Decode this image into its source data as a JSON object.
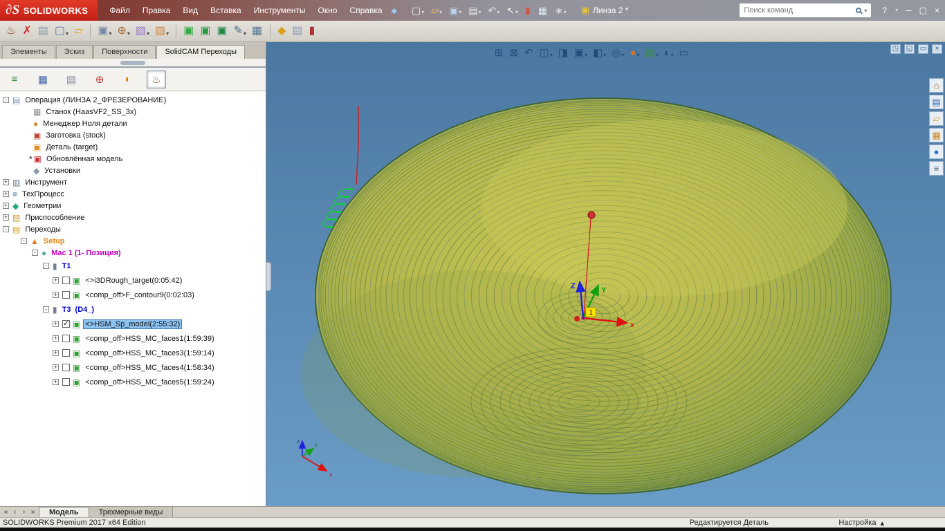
{
  "titlebar": {
    "logo_mark": "∂S",
    "logo_text": "SOLIDWORKS",
    "menus": [
      "Файл",
      "Правка",
      "Вид",
      "Вставка",
      "Инструменты",
      "Окно",
      "Справка"
    ],
    "toolbar_icons": [
      {
        "n": "new-document-icon",
        "g": "▢",
        "c": "#eef3f8",
        "d": "▾"
      },
      {
        "n": "open-document-icon",
        "g": "▱",
        "c": "#f3c96a",
        "d": "▾"
      },
      {
        "n": "save-icon",
        "g": "▣",
        "c": "#bcd2ee",
        "d": "▾"
      },
      {
        "n": "print-icon",
        "g": "▤",
        "c": "#e8e8e8",
        "d": "▾"
      },
      {
        "n": "undo-icon",
        "g": "↶",
        "c": "#e8e8e8",
        "d": "▾"
      },
      {
        "n": "select-cursor-icon",
        "g": "↖",
        "c": "#f2f2f2",
        "d": "▾"
      },
      {
        "n": "rebuild-icon",
        "g": "▮",
        "c": "#cc5544",
        "d": ""
      },
      {
        "n": "task-list-icon",
        "g": "▦",
        "c": "#dce6f0",
        "d": ""
      },
      {
        "n": "options-gear-icon",
        "g": "∗",
        "c": "#e4e4e4",
        "d": "▾"
      }
    ],
    "doc_title": "Линза 2 *",
    "search_placeholder": "Поиск команд",
    "window": {
      "help": "?",
      "help_dd": "▾",
      "min": "─",
      "max": "▢",
      "close": "×"
    }
  },
  "solidcam_toolbar": [
    {
      "n": "solidcam-icon",
      "g": "♨",
      "c": "#8a4a20",
      "d": "",
      "cls": ""
    },
    {
      "n": "close-part-icon",
      "g": "✗",
      "c": "#cc2222",
      "d": "",
      "cls": ""
    },
    {
      "n": "save-cam-icon",
      "g": "▤",
      "c": "#8899aa",
      "d": "",
      "cls": ""
    },
    {
      "n": "new-cam-part-icon",
      "g": "▢",
      "c": "#5577aa",
      "d": "▾",
      "cls": ""
    },
    {
      "n": "open-cam-part-icon",
      "g": "▱",
      "c": "#d9a21b",
      "d": "",
      "cls": ""
    },
    {
      "n": "separator",
      "g": "",
      "c": "",
      "d": "",
      "cls": "sep"
    },
    {
      "n": "machine-setup-icon",
      "g": "▣",
      "c": "#7788aa",
      "d": "▾",
      "cls": ""
    },
    {
      "n": "coordinate-manager-icon",
      "g": "⊕",
      "c": "#aa6633",
      "d": "▾",
      "cls": ""
    },
    {
      "n": "stock-model-icon",
      "g": "▧",
      "c": "#9977cc",
      "d": "▾",
      "cls": ""
    },
    {
      "n": "target-model-icon",
      "g": "▨",
      "c": "#cc8844",
      "d": "▾",
      "cls": ""
    },
    {
      "n": "separator",
      "g": "",
      "c": "",
      "d": "",
      "cls": "sep"
    },
    {
      "n": "operation-2d-icon",
      "g": "▣",
      "c": "#33aa44",
      "d": "",
      "cls": ""
    },
    {
      "n": "operation-3d-icon",
      "g": "▣",
      "c": "#2a9944",
      "d": "",
      "cls": ""
    },
    {
      "n": "operation-hsm-icon",
      "g": "▣",
      "c": "#22884a",
      "d": "",
      "cls": ""
    },
    {
      "n": "edit-operation-icon",
      "g": "✎",
      "c": "#446688",
      "d": "▾",
      "cls": ""
    },
    {
      "n": "calculator-icon",
      "g": "▦",
      "c": "#557799",
      "d": "",
      "cls": ""
    },
    {
      "n": "separator",
      "g": "",
      "c": "",
      "d": "",
      "cls": "sep"
    },
    {
      "n": "license-key-icon",
      "g": "◆",
      "c": "#d9a21b",
      "d": "",
      "cls": ""
    },
    {
      "n": "documentation-icon",
      "g": "▤",
      "c": "#8899bb",
      "d": "",
      "cls": ""
    },
    {
      "n": "material-db-icon",
      "g": "▮",
      "c": "#aa3333",
      "d": "",
      "cls": ""
    }
  ],
  "command_tabs": [
    {
      "label": "Элементы",
      "cls": ""
    },
    {
      "label": "Эскиз",
      "cls": ""
    },
    {
      "label": "Поверхности",
      "cls": ""
    },
    {
      "label": "SolidCAM Переходы",
      "cls": "active"
    }
  ],
  "manager_tabs": [
    {
      "n": "featuremanager-tab",
      "g": "≡",
      "c": "#3a8a3a",
      "cls": ""
    },
    {
      "n": "propertymanager-tab",
      "g": "▦",
      "c": "#4466aa",
      "cls": ""
    },
    {
      "n": "configurationmanager-tab",
      "g": "▤",
      "c": "#888899",
      "cls": ""
    },
    {
      "n": "dimxpertmanager-tab",
      "g": "⊕",
      "c": "#cc3333",
      "cls": ""
    },
    {
      "n": "displaymanager-tab",
      "g": "◐",
      "c": "#dd8800",
      "cls": ""
    },
    {
      "n": "solidcam-manager-tab",
      "g": "♨",
      "c": "#8a4a20",
      "cls": "active"
    }
  ],
  "tree": {
    "items": [
      {
        "ml": "4px",
        "exp": "-",
        "pre": "",
        "glyph": "▤",
        "gc": "#7a8fb5",
        "label": "Операция (ЛИНЗА 2_ФРЕЗЕРОВАНИЕ)",
        "cls": ""
      },
      {
        "ml": "34px",
        "exp": "",
        "pre": "",
        "glyph": "▦",
        "gc": "#8a8f98",
        "label": "Станок (HaasVF2_SS_3x)",
        "cls": ""
      },
      {
        "ml": "34px",
        "exp": "",
        "pre": "",
        "glyph": "●",
        "gc": "#cc8833",
        "label": "Менеджер Ноля детали",
        "cls": ""
      },
      {
        "ml": "34px",
        "exp": "",
        "pre": "",
        "glyph": "▣",
        "gc": "#bb4433",
        "label": "Заготовка (stock)",
        "cls": ""
      },
      {
        "ml": "34px",
        "exp": "",
        "pre": "",
        "glyph": "▣",
        "gc": "#dd8822",
        "label": "Деталь (target)",
        "cls": ""
      },
      {
        "ml": "28px",
        "exp": "",
        "pre": "*",
        "glyph": "▣",
        "gc": "#cc3333",
        "label": "Обновлённая модель",
        "cls": ""
      },
      {
        "ml": "34px",
        "exp": "",
        "pre": "",
        "glyph": "◆",
        "gc": "#8899aa",
        "label": "Установки",
        "cls": ""
      },
      {
        "ml": "4px",
        "exp": "+",
        "pre": "",
        "glyph": "▥",
        "gc": "#667788",
        "label": "Инструмент",
        "cls": ""
      },
      {
        "ml": "4px",
        "exp": "+",
        "pre": "",
        "glyph": "≡",
        "gc": "#336699",
        "label": "ТехПроцесс",
        "cls": ""
      },
      {
        "ml": "4px",
        "exp": "+",
        "pre": "",
        "glyph": "◆",
        "gc": "#22aa77",
        "label": "Геометрии",
        "cls": ""
      },
      {
        "ml": "4px",
        "exp": "+",
        "pre": "",
        "glyph": "▤",
        "gc": "#c8961e",
        "label": "Приспособление",
        "cls": ""
      },
      {
        "ml": "4px",
        "exp": "-",
        "pre": "",
        "glyph": "▤",
        "gc": "#e0a020",
        "label": "Переходы",
        "cls": ""
      },
      {
        "ml": "30px",
        "exp": "-",
        "pre": "",
        "glyph": "▲",
        "gc": "#e07820",
        "label": "Setup",
        "cls": "orange"
      },
      {
        "ml": "46px",
        "exp": "-",
        "pre": "",
        "glyph": "●",
        "gc": "#55aa99",
        "label": "Mac 1 (1- Позиция)",
        "cls": "magenta"
      },
      {
        "ml": "62px",
        "exp": "-",
        "pre": "",
        "glyph": "▮",
        "gc": "#708090",
        "label": "T1",
        "cls": "blue tall"
      },
      {
        "ml": "76px",
        "exp": "+",
        "pre": "",
        "glyph": "▣",
        "gc": "#33a033",
        "label": "<>i3DRough_target(0:05:42)",
        "cls": "ck0 tall"
      },
      {
        "ml": "76px",
        "exp": "+",
        "pre": "",
        "glyph": "▣",
        "gc": "#33a033",
        "label": "<comp_off>F_contour9(0:02:03)",
        "cls": "ck0 tall"
      },
      {
        "ml": "62px",
        "exp": "-",
        "pre": "",
        "glyph": "▮",
        "gc": "#708090",
        "label": "T3  (D4_)",
        "cls": "blue tall"
      },
      {
        "ml": "76px",
        "exp": "+",
        "pre": "",
        "glyph": "▣",
        "gc": "#33a033",
        "label": "<>HSM_Sp_model(2:55:32)",
        "cls": "ck1 sel tall"
      },
      {
        "ml": "76px",
        "exp": "+",
        "pre": "",
        "glyph": "▣",
        "gc": "#33a033",
        "label": "<comp_off>HSS_MC_faces1(1:59:39)",
        "cls": "ck0 tall"
      },
      {
        "ml": "76px",
        "exp": "+",
        "pre": "",
        "glyph": "▣",
        "gc": "#33a033",
        "label": "<comp_off>HSS_MC_faces3(1:59:14)",
        "cls": "ck0 tall"
      },
      {
        "ml": "76px",
        "exp": "+",
        "pre": "",
        "glyph": "▣",
        "gc": "#33a033",
        "label": "<comp_off>HSS_MC_faces4(1:58:34)",
        "cls": "ck0 tall"
      },
      {
        "ml": "76px",
        "exp": "+",
        "pre": "",
        "glyph": "▣",
        "gc": "#33a033",
        "label": "<comp_off>HSS_MC_faces5(1:59:24)",
        "cls": "ck0 tall"
      }
    ]
  },
  "viewport": {
    "hud_icons": [
      {
        "n": "zoom-fit-icon",
        "g": "⊞",
        "c": "#1f4e79",
        "d": ""
      },
      {
        "n": "zoom-area-icon",
        "g": "⊠",
        "c": "#1f4e79",
        "d": ""
      },
      {
        "n": "previous-view-icon",
        "g": "↶",
        "c": "#1f4e79",
        "d": ""
      },
      {
        "n": "section-view-icon",
        "g": "◫",
        "c": "#1f4e79",
        "d": "▾"
      },
      {
        "n": "annotation-view-icon",
        "g": "◨",
        "c": "#1f4e79",
        "d": ""
      },
      {
        "n": "view-orientation-icon",
        "g": "▣",
        "c": "#1f4e79",
        "d": "▾"
      },
      {
        "n": "display-style-icon",
        "g": "◧",
        "c": "#1f4e79",
        "d": "▾"
      },
      {
        "n": "hide-show-items-icon",
        "g": "◎",
        "c": "#1f4e79",
        "d": "▾"
      },
      {
        "n": "edit-appearance-icon",
        "g": "●",
        "c": "#d4722a",
        "d": "▾"
      },
      {
        "n": "apply-scene-icon",
        "g": "▦",
        "c": "#3a8a5a",
        "d": "▾"
      },
      {
        "n": "view-settings-icon",
        "g": "◐",
        "c": "#1f4e79",
        "d": "▾"
      },
      {
        "n": "full-screen-icon",
        "g": "▭",
        "c": "#1f4e79",
        "d": ""
      }
    ],
    "window_icons": [
      {
        "n": "window-restore-icon",
        "g": "◳"
      },
      {
        "n": "window-tile-icon",
        "g": "◱"
      },
      {
        "n": "window-minimize-icon",
        "g": "▭"
      },
      {
        "n": "window-close-icon",
        "g": "×"
      }
    ],
    "taskpane_icons": [
      {
        "n": "home-icon",
        "g": "⌂",
        "c": "#b06010"
      },
      {
        "n": "design-library-icon",
        "g": "▤",
        "c": "#3366aa"
      },
      {
        "n": "file-explorer-icon",
        "g": "▱",
        "c": "#d9a21b"
      },
      {
        "n": "view-palette-icon",
        "g": "▦",
        "c": "#cc8822"
      },
      {
        "n": "appearances-icon",
        "g": "●",
        "c": "#2277cc"
      },
      {
        "n": "custom-properties-icon",
        "g": "≡",
        "c": "#556677"
      }
    ],
    "triad": {
      "x": "x",
      "y": "Y",
      "z": "Z",
      "tag": "1"
    },
    "mini_triad": {
      "x": "x",
      "y": "y",
      "z": "z"
    }
  },
  "bottom": {
    "nav": [
      "«",
      "‹",
      "›",
      "»"
    ],
    "tabs": [
      {
        "label": "Модель",
        "cls": "active"
      },
      {
        "label": "Трехмерные виды",
        "cls": ""
      }
    ]
  },
  "statusbar": {
    "left": "SOLIDWORKS Premium 2017 x64 Edition",
    "mode": "Редактируется Деталь",
    "custom": "Настройка",
    "caret": "▴"
  }
}
